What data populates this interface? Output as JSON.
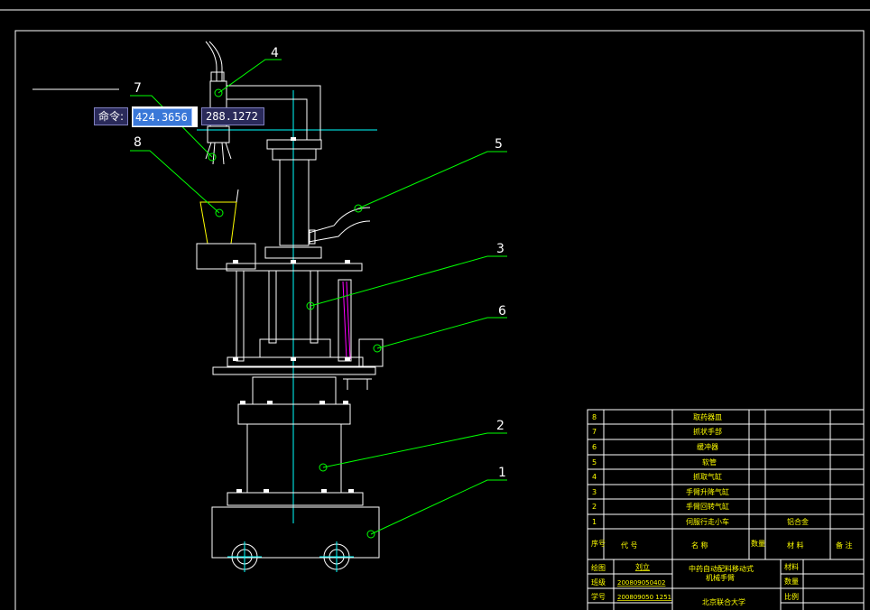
{
  "command": {
    "label": "命令:",
    "x_value": "424.3656",
    "y_value": "288.1272"
  },
  "callouts": [
    "4",
    "7",
    "8",
    "5",
    "3",
    "6",
    "2",
    "1"
  ],
  "bom_rows": [
    {
      "no": "8",
      "name": "取药器皿",
      "material": ""
    },
    {
      "no": "7",
      "name": "抓状手部",
      "material": ""
    },
    {
      "no": "6",
      "name": "缓冲器",
      "material": ""
    },
    {
      "no": "5",
      "name": "软管",
      "material": ""
    },
    {
      "no": "4",
      "name": "抓取气缸",
      "material": ""
    },
    {
      "no": "3",
      "name": "手臂升降气缸",
      "material": ""
    },
    {
      "no": "2",
      "name": "手臂回转气缸",
      "material": ""
    },
    {
      "no": "1",
      "name": "伺服行走小车",
      "material": "铝合金"
    }
  ],
  "bom_header": {
    "no": "序号",
    "code": "代 号",
    "name": "名 称",
    "qty": "数量",
    "material": "材 料",
    "note": "备 注"
  },
  "title_block": {
    "drawn_label": "绘图",
    "drawn_value": "刘立",
    "class_label": "班级",
    "class_value": "200809050402",
    "id_label": "学号",
    "id_value": "200809050 1251",
    "title_line1": "中药自动配料移动式",
    "title_line2": "机械手臂",
    "school": "北京联合大学",
    "material_label": "材料",
    "qty_label": "数量",
    "scale_label": "比例"
  },
  "colors": {
    "background": "#000000",
    "outline": "#ffffff",
    "leader": "#00ff00",
    "centerline": "#00ffff",
    "callout_text": "#ffffff",
    "table_text": "#ffff00",
    "spring": "#ff00ff"
  }
}
